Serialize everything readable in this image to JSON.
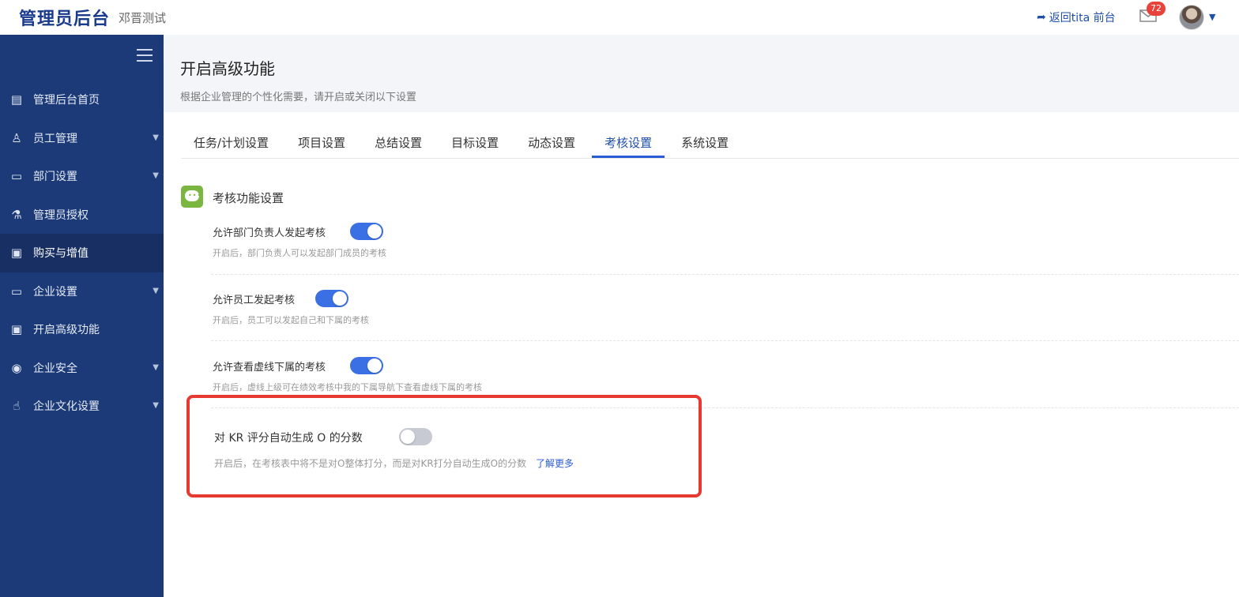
{
  "topbar": {
    "title": "管理员后台",
    "subtitle": "邓晋测试",
    "back_link": "返回tita 前台",
    "mail_badge": "72"
  },
  "sidebar": {
    "items": [
      {
        "label": "管理后台首页",
        "icon": "dashboard-icon"
      },
      {
        "label": "员工管理",
        "icon": "user-list-icon"
      },
      {
        "label": "部门设置",
        "icon": "document-icon"
      },
      {
        "label": "管理员授权",
        "icon": "flask-icon"
      },
      {
        "label": "购买与增值",
        "icon": "book-icon"
      },
      {
        "label": "企业设置",
        "icon": "monitor-icon"
      },
      {
        "label": "开启高级功能",
        "icon": "book-icon"
      },
      {
        "label": "企业安全",
        "icon": "shield-icon"
      },
      {
        "label": "企业文化设置",
        "icon": "hand-icon"
      }
    ]
  },
  "page": {
    "title": "开启高级功能",
    "description": "根据企业管理的个性化需要，请开启或关闭以下设置"
  },
  "tabs": [
    "任务/计划设置",
    "项目设置",
    "总结设置",
    "目标设置",
    "动态设置",
    "考核设置",
    "系统设置"
  ],
  "active_tab": "考核设置",
  "section": {
    "title": "考核功能设置"
  },
  "settings": [
    {
      "label": "允许部门负责人发起考核",
      "desc": "开启后，部门负责人可以发起部门成员的考核",
      "enabled": true
    },
    {
      "label": "允许员工发起考核",
      "desc": "开启后，员工可以发起自己和下属的考核",
      "enabled": true
    },
    {
      "label": "允许查看虚线下属的考核",
      "desc": "开启后，虚线上级可在绩效考核中我的下属导航下查看虚线下属的考核",
      "enabled": true
    },
    {
      "label": "对 KR 评分自动生成 O 的分数",
      "desc": "开启后，在考核表中将不是对O整体打分，而是对KR打分自动生成O的分数",
      "link": "了解更多",
      "enabled": false
    }
  ],
  "colors": {
    "sidebar_bg": "#1c3a78",
    "accent": "#3a70e4",
    "highlight_border": "#e6392f"
  }
}
